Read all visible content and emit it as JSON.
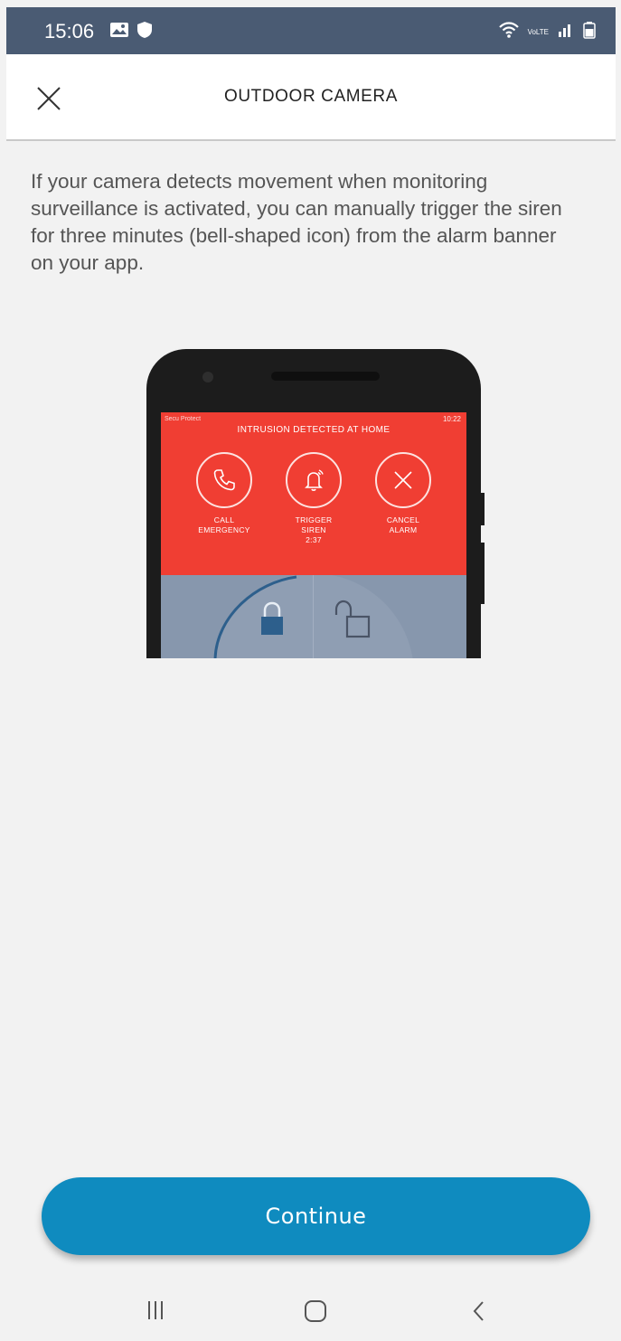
{
  "status_bar": {
    "time": "15:06",
    "icons": [
      "gallery-icon",
      "shield-icon",
      "wifi-icon",
      "volte-icon",
      "signal-icon",
      "battery-icon"
    ],
    "volte_text": "VoLTE"
  },
  "header": {
    "title": "OUTDOOR CAMERA",
    "close_icon": "close-icon"
  },
  "description": "If your camera detects movement when monitoring surveillance is activated, you can manually trigger the siren for three minutes (bell-shaped icon) from the alarm banner on your app.",
  "illustration": {
    "status_left": "Secu Protect",
    "status_right": "10:22",
    "banner_title": "INTRUSION DETECTED AT HOME",
    "actions": [
      {
        "icon": "phone-icon",
        "label": "CALL\nEMERGENCY"
      },
      {
        "icon": "bell-icon",
        "label": "TRIGGER\nSIREN\n2:37"
      },
      {
        "icon": "x-icon",
        "label": "CANCEL\nALARM"
      }
    ],
    "banner_color": "#f03e33",
    "screen_color": "#8797ad"
  },
  "continue_button": {
    "label": "Continue",
    "color": "#0f8bbf"
  },
  "nav_bar": {
    "items": [
      "recents-icon",
      "home-icon",
      "back-icon"
    ]
  }
}
